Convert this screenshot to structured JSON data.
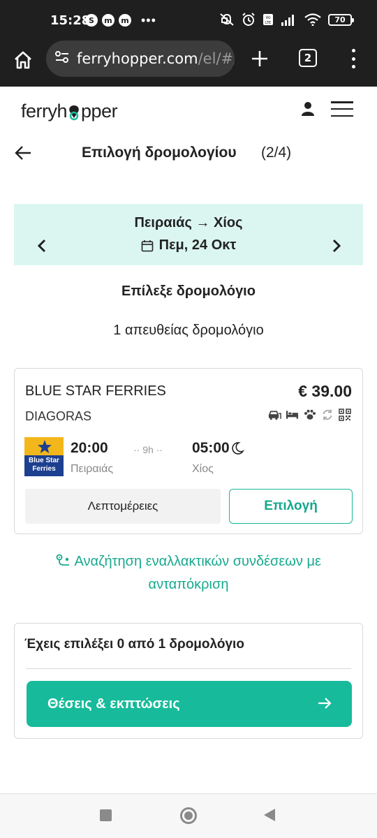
{
  "status_bar": {
    "time": "15:28",
    "app_icons": [
      "S",
      "m",
      "m"
    ],
    "more": "•••",
    "battery": "70",
    "icons": [
      "mute-icon",
      "alarm-icon",
      "volte-icon",
      "signal-icon",
      "wifi-icon",
      "battery-icon"
    ]
  },
  "browser": {
    "url_main": "ferryhopper.com",
    "url_dim": "/el/#/",
    "tab_count": "2"
  },
  "site": {
    "logo_left": "ferryh",
    "logo_right": "pper"
  },
  "step": {
    "title": "Επιλογή δρομολογίου",
    "count": "(2/4)"
  },
  "route": {
    "text": "Πειραιάς → Χίος",
    "date": "Πεμ, 24 Οκτ"
  },
  "choose_title": "Επίλεξε δρομολόγιο",
  "direct_count": "1 απευθείας δρομολόγιο",
  "trip": {
    "company": "BLUE STAR FERRIES",
    "price": "€ 39.00",
    "vessel": "DIAGORAS",
    "amenities": [
      "car-icon",
      "bed-icon",
      "pet-icon",
      "refresh-icon",
      "qr-code-icon"
    ],
    "operator_logo_lines": [
      "Blue Star",
      "Ferries"
    ],
    "departure_time": "20:00",
    "departure_port": "Πειραιάς",
    "duration": "·· 9h ··",
    "arrival_time": "05:00",
    "arrival_port": "Χίος",
    "details_label": "Λεπτομέρειες",
    "select_label": "Επιλογή"
  },
  "alt_search": "Αναζήτηση εναλλακτικών συνδέσεων με ανταπόκριση",
  "summary": {
    "text": "Έχεις επιλέξει 0 από 1 δρομολόγιο",
    "button_label": "Θέσεις & εκπτώσεις"
  },
  "colors": {
    "accent": "#17bb9b",
    "accent_text": "#13a88c",
    "banner_bg": "#dbf6f1",
    "brand_blue": "#1d3f8f",
    "brand_yellow": "#f3b71c"
  }
}
